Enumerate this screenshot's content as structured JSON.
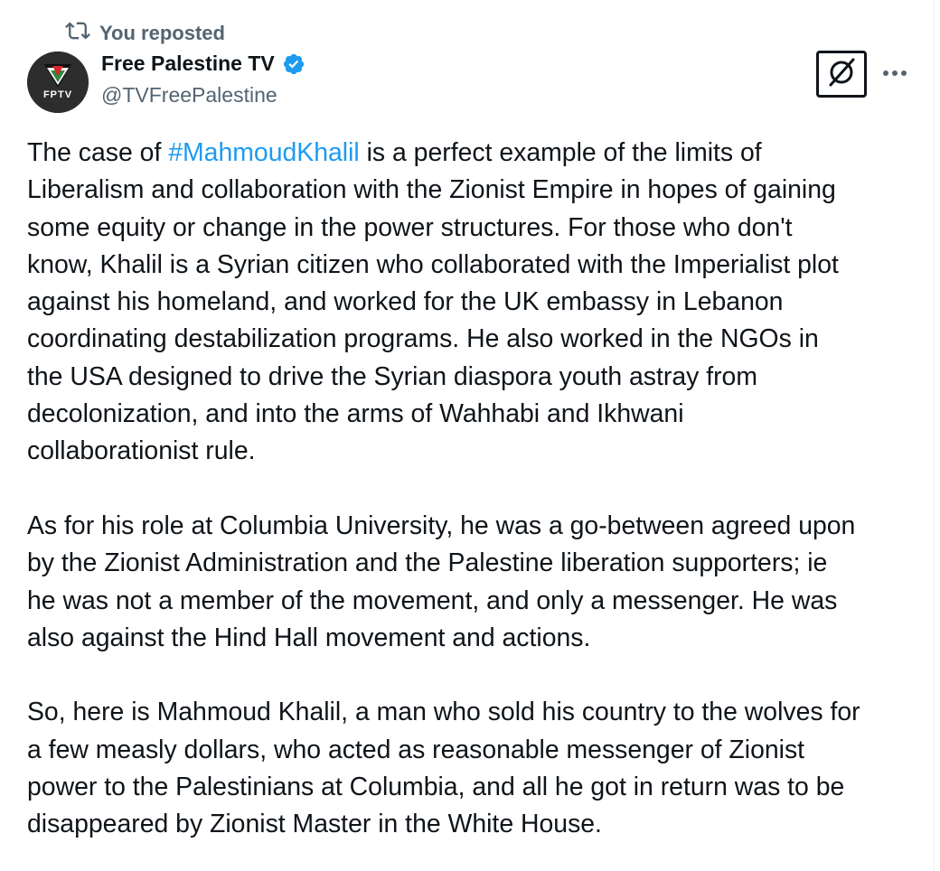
{
  "repost_label": "You reposted",
  "author": {
    "display_name": "Free Palestine TV",
    "handle": "@TVFreePalestine",
    "avatar_text": "FPTV",
    "verified": true
  },
  "icons": {
    "repost": "repost-icon",
    "verified": "verified-badge-icon",
    "grok": "grok-icon",
    "more": "more-icon"
  },
  "colors": {
    "link": "#1d9bf0",
    "secondary_text": "#536471",
    "primary_text": "#0f1419",
    "verified": "#1d9bf0"
  },
  "tweet": {
    "line01_pre": "The case of ",
    "hashtag": "#MahmoudKhalil",
    "line01_post": " is a perfect example of the limits of",
    "line02": "Liberalism and collaboration with the Zionist Empire in hopes of gaining",
    "line03": "some equity or change in the power structures. For those who don't",
    "line04": "know, Khalil is a Syrian citizen who collaborated with the Imperialist plot",
    "line05": "against his homeland, and worked for the UK embassy in Lebanon",
    "line06": "coordinating destabilization programs. He also worked in the NGOs in",
    "line07": "the USA designed to drive the Syrian diaspora youth astray from",
    "line08": "decolonization, and into the arms of Wahhabi and Ikhwani",
    "line09": "collaborationist rule.",
    "line11": "As for his role at Columbia University, he was a go-between agreed upon",
    "line12": "by the Zionist Administration and the Palestine liberation supporters; ie",
    "line13": "he was not a member of the movement, and only a messenger. He was",
    "line14": "also against the Hind Hall movement and actions.",
    "line16": "So, here is Mahmoud Khalil, a man who sold his country to the wolves for",
    "line17": "a few measly dollars, who acted as reasonable messenger of Zionist",
    "line18": "power to the Palestinians at Columbia, and all he got in return was to be",
    "line19": "disappeared by Zionist Master in the White House."
  }
}
